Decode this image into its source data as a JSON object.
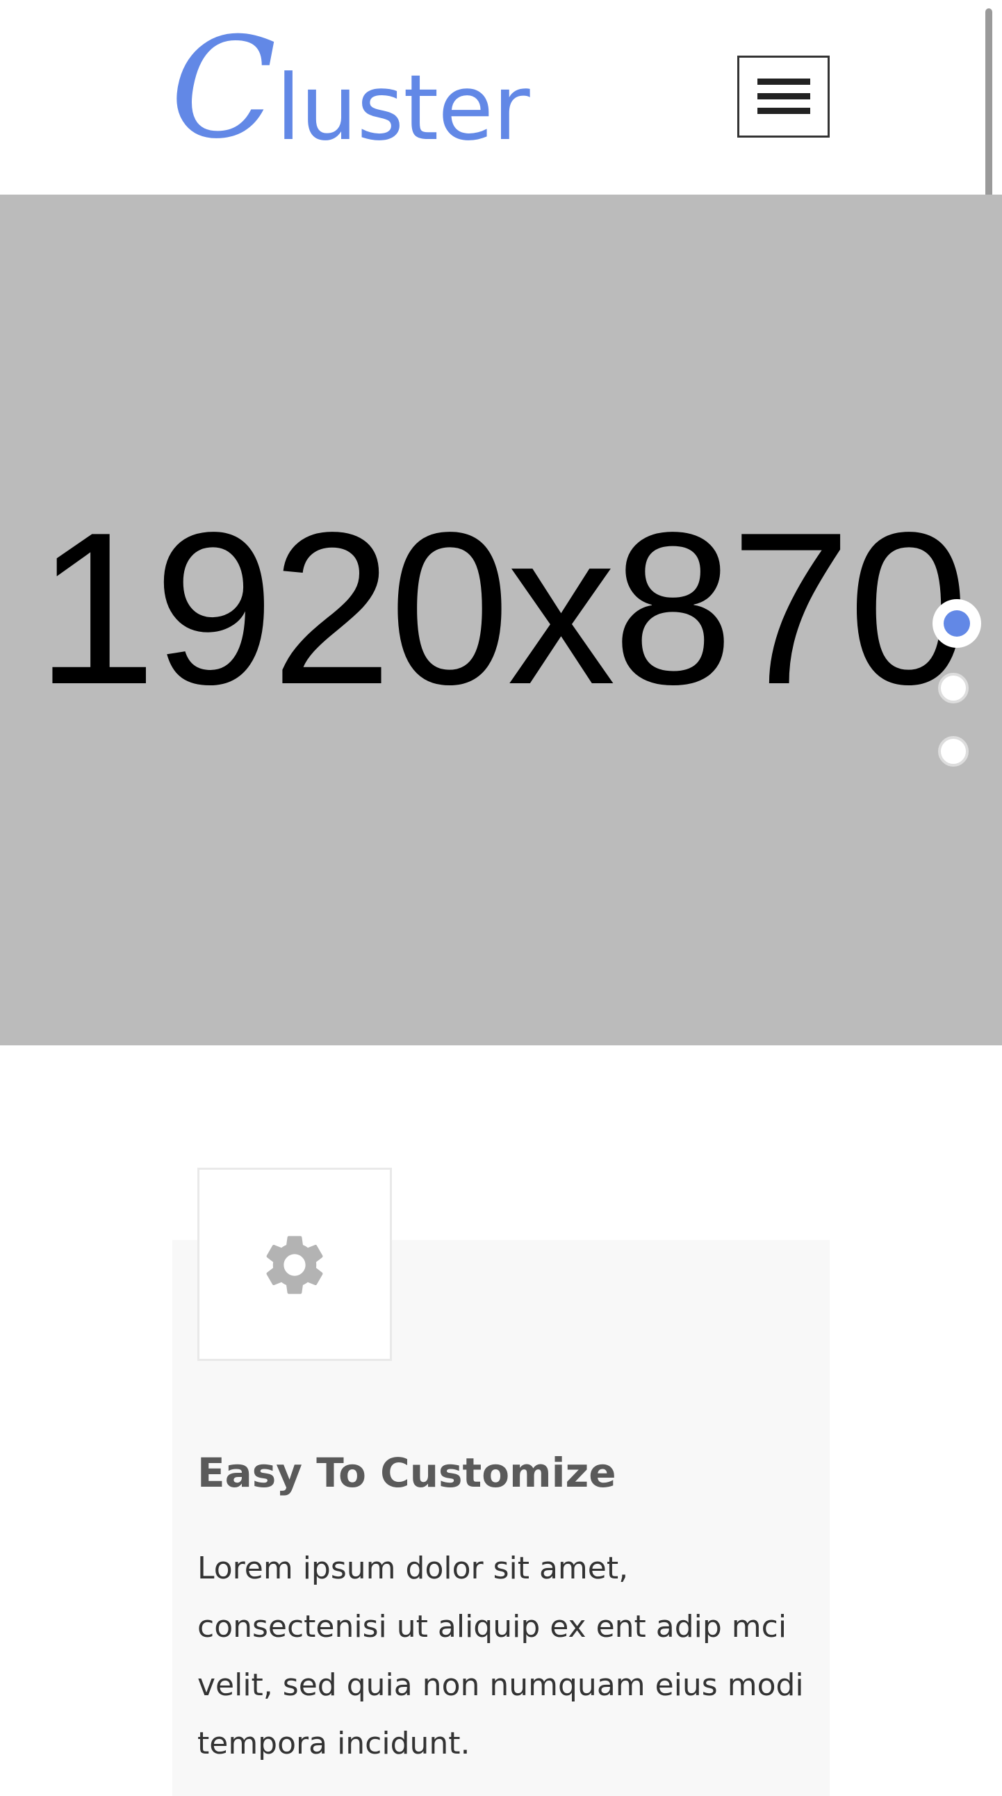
{
  "header": {
    "logo": {
      "initial": "C",
      "rest": "luster"
    },
    "menu_icon": "hamburger-menu-icon"
  },
  "hero": {
    "placeholder_text": "1920x870",
    "slider_dots": [
      {
        "active": true
      },
      {
        "active": false
      },
      {
        "active": false
      }
    ]
  },
  "feature": {
    "icon": "gear-icon",
    "title": "Easy To Customize",
    "text": "Lorem ipsum dolor sit amet, consectenisi ut aliquip ex ent adip mci velit, sed quia non numquam eius modi tempora incidunt."
  },
  "colors": {
    "brand": "#6288e6",
    "hero_bg": "#bbbbbb",
    "card_bg": "#f8f8f8",
    "title": "#5a5a5a",
    "icon": "#b3b3b3"
  }
}
